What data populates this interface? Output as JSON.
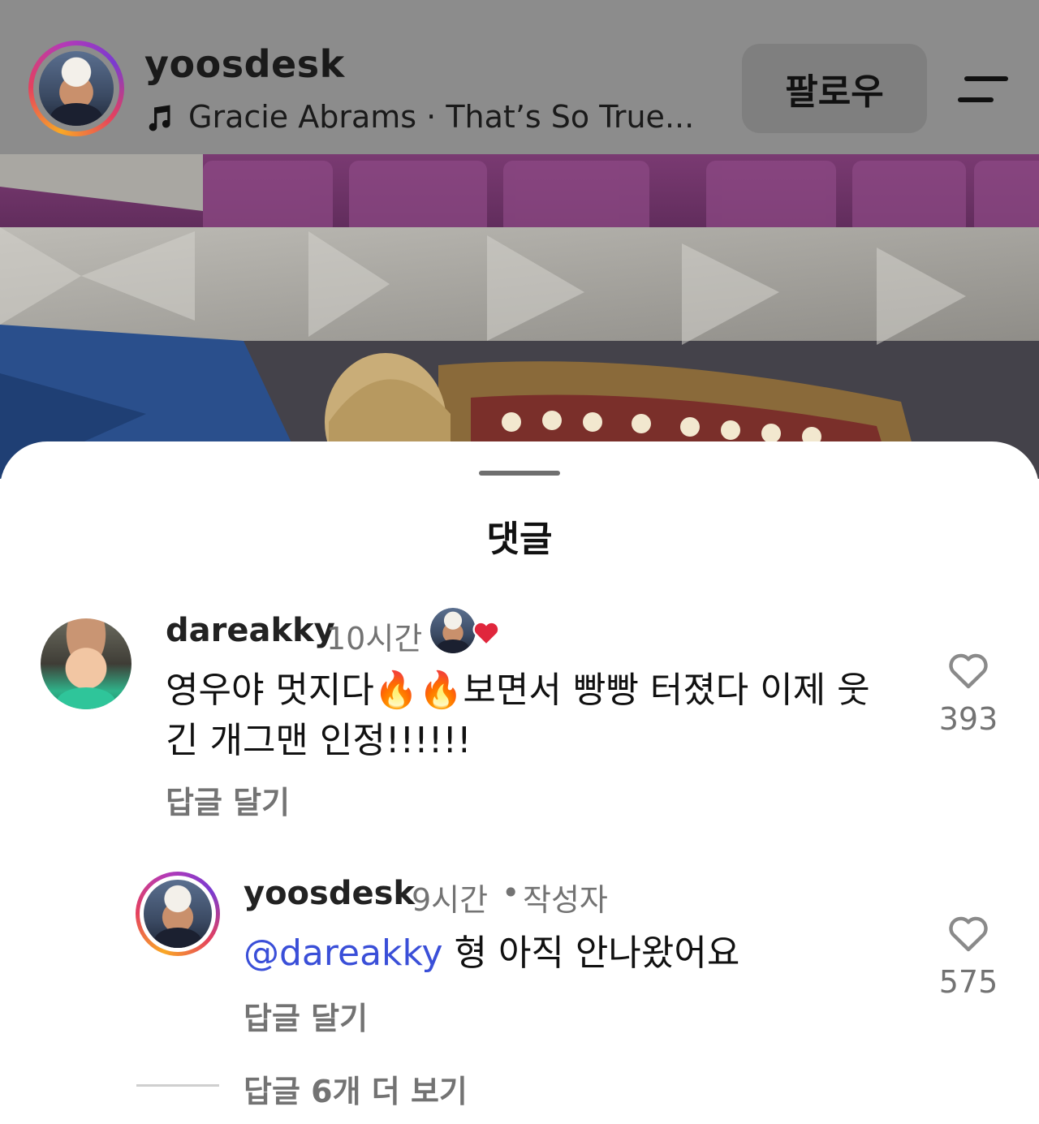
{
  "header": {
    "username": "yoosdesk",
    "music_icon": "music-note-icon",
    "music": "Gracie Abrams · That’s So True...",
    "follow_label": "팔로우",
    "menu_icon": "menu-icon"
  },
  "sheet": {
    "title": "댓글"
  },
  "comments": [
    {
      "username": "dareakky",
      "time": "10시간",
      "author_liked_icon": "heart-icon",
      "text": "영우야 멋지다🔥🔥보면서 빵빵 터졌다 이제 웃긴 개그맨 인정!!!!!!",
      "reply_label": "답글 달기",
      "like_icon": "heart-outline-icon",
      "likes": "393"
    },
    {
      "username": "yoosdesk",
      "time": "9시간",
      "separator": "•",
      "author_tag": "작성자",
      "mention": "@dareakky",
      "text": "형 아직 안나왔어요",
      "reply_label": "답글 달기",
      "like_icon": "heart-outline-icon",
      "likes": "575"
    }
  ],
  "more_replies": "답글 6개 더 보기",
  "colors": {
    "header_bg": "#8c8c8c",
    "mention": "#3a4fd8",
    "muted_text": "#737373",
    "heart_red": "#e0263c"
  }
}
